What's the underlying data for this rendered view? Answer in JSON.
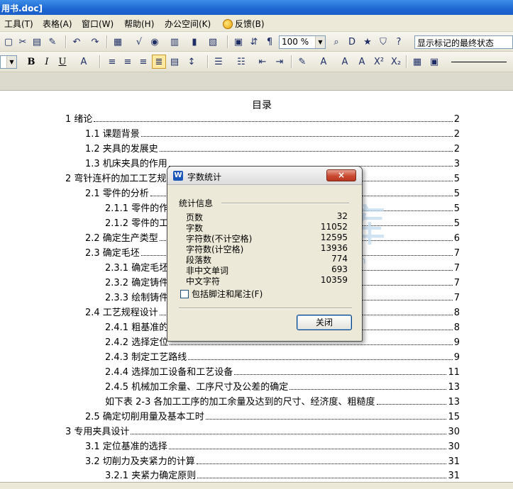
{
  "window": {
    "title": "用书.doc]"
  },
  "menu": {
    "items": [
      "工具(T)",
      "表格(A)",
      "窗口(W)",
      "帮助(H)",
      "办公空间(K)"
    ],
    "feedback": "反馈(B)"
  },
  "toolbar1": {
    "zoom": "100 %",
    "markup_view": "显示标记的最终状态"
  },
  "toolbar2": {
    "bold": "B",
    "italic": "I",
    "underline": "U"
  },
  "document": {
    "toc_title": "目录",
    "toc": [
      {
        "text": "1 绪论",
        "page": "2"
      },
      {
        "text": "1.1 课题背景",
        "page": "2"
      },
      {
        "text": "1.2 夹具的发展史",
        "page": "2"
      },
      {
        "text": "1.3  机床夹具的作用",
        "page": "3"
      },
      {
        "text": "2 弯针连杆的加工工艺规",
        "page": "5"
      },
      {
        "text": "2.1 零件的分析",
        "page": "5"
      },
      {
        "text": "2.1.1 零件的作",
        "page": "5"
      },
      {
        "text": "2.1.2 零件的工",
        "page": "5"
      },
      {
        "text": "2.2 确定生产类型",
        "page": "6"
      },
      {
        "text": "2.3 确定毛坯",
        "page": "7"
      },
      {
        "text": "2.3.1 确定毛坯",
        "page": "7"
      },
      {
        "text": "2.3.2 确定铸件",
        "page": "7"
      },
      {
        "text": "2.3.3 绘制铸件",
        "page": "7"
      },
      {
        "text": "2.4 工艺规程设计",
        "page": "8"
      },
      {
        "text": "2.4.1  粗基准的",
        "page": "8"
      },
      {
        "text": "2.4.2 选择定位",
        "page": "9"
      },
      {
        "text": "2.4.3 制定工艺路线",
        "page": "9"
      },
      {
        "text": "2.4.4 选择加工设备和工艺设备",
        "page": "11"
      },
      {
        "text": "2.4.5 机械加工余量、工序尺寸及公差的确定",
        "page": "13"
      },
      {
        "text": "如下表 2-3 各加工工序的加工余量及达到的尺寸、经济度、粗糙度",
        "page": "13"
      },
      {
        "text": "2.5 确定切削用量及基本工时",
        "page": "15"
      },
      {
        "text": "3 专用夹具设计",
        "page": "30"
      },
      {
        "text": "3.1 定位基准的选择",
        "page": "30"
      },
      {
        "text": "3.2 切削力及夹紧力的计算",
        "page": "31"
      },
      {
        "text": "3.2.1 夹紧力确定原则",
        "page": "31"
      }
    ]
  },
  "dialog": {
    "title": "字数统计",
    "group_title": "统计信息",
    "stats": [
      {
        "label": "页数",
        "value": "32"
      },
      {
        "label": "字数",
        "value": "11052"
      },
      {
        "label": "字符数(不计空格)",
        "value": "12595"
      },
      {
        "label": "字符数(计空格)",
        "value": "13936"
      },
      {
        "label": "段落数",
        "value": "774"
      },
      {
        "label": "非中文单词",
        "value": "693"
      },
      {
        "label": "中文字符",
        "value": "10359"
      }
    ],
    "include_notes": "包括脚注和尾注(F)",
    "close_button": "关闭",
    "close_x": "×"
  },
  "watermark": {
    "text": "文库",
    "url": "www.renrendoc.com"
  }
}
